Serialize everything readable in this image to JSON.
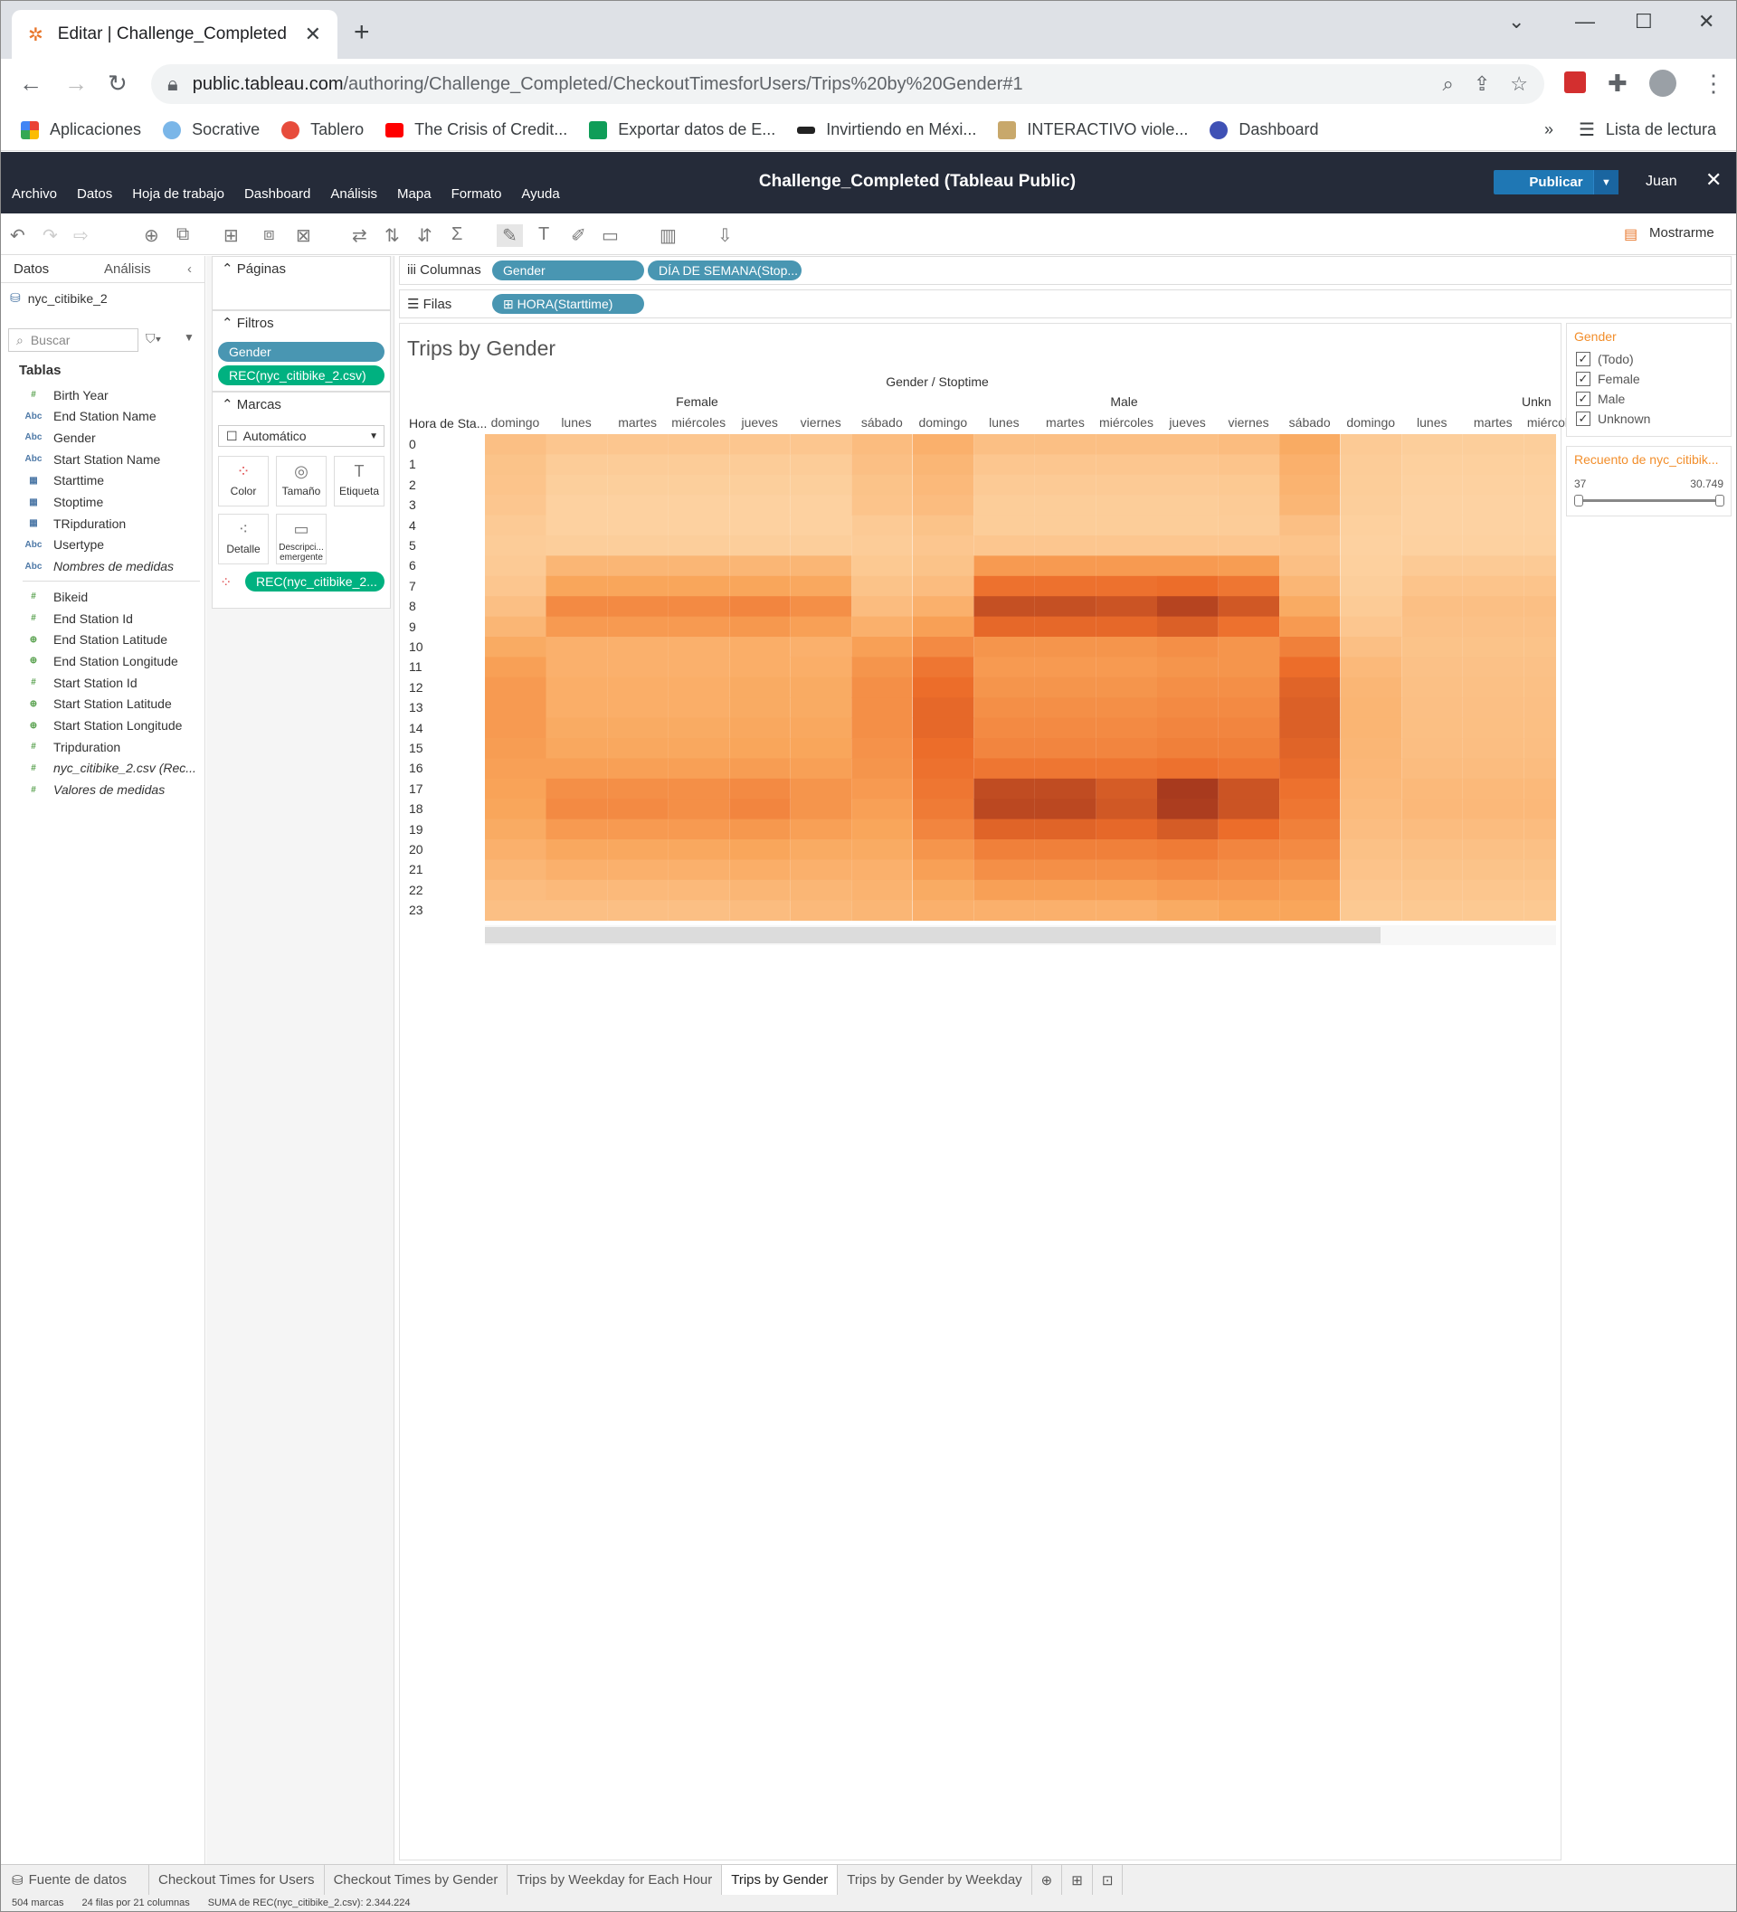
{
  "browser": {
    "tab_title": "Editar | Challenge_Completed",
    "url_host": "public.tableau.com",
    "url_path": "/authoring/Challenge_Completed/CheckoutTimesforUsers/Trips%20by%20Gender#1",
    "bookmarks": [
      "Aplicaciones",
      "Socrative",
      "Tablero",
      "The Crisis of Credit...",
      "Exportar datos de E...",
      "Invirtiendo en Méxi...",
      "INTERACTIVO viole...",
      "Dashboard"
    ],
    "bookmark_more": "»",
    "reading_list": "Lista de lectura"
  },
  "app": {
    "menu": [
      "Archivo",
      "Datos",
      "Hoja de trabajo",
      "Dashboard",
      "Análisis",
      "Mapa",
      "Formato",
      "Ayuda"
    ],
    "title": "Challenge_Completed (Tableau Public)",
    "publish": "Publicar",
    "user": "Juan",
    "showme": "Mostrarme"
  },
  "datapane": {
    "tab_data": "Datos",
    "tab_analysis": "Análisis",
    "datasource": "nyc_citibike_2",
    "search_placeholder": "Buscar",
    "tables_label": "Tablas",
    "fields": [
      {
        "icon": "#",
        "name": "Birth Year",
        "type": "m"
      },
      {
        "icon": "Abc",
        "name": "End Station Name",
        "type": "d"
      },
      {
        "icon": "Abc",
        "name": "Gender",
        "type": "d"
      },
      {
        "icon": "Abc",
        "name": "Start Station Name",
        "type": "d"
      },
      {
        "icon": "cal",
        "name": "Starttime",
        "type": "d"
      },
      {
        "icon": "cal",
        "name": "Stoptime",
        "type": "d"
      },
      {
        "icon": "cal",
        "name": "TRipduration",
        "type": "d"
      },
      {
        "icon": "Abc",
        "name": "Usertype",
        "type": "d"
      },
      {
        "icon": "Abc",
        "name": "Nombres de medidas",
        "type": "d"
      },
      {
        "icon": "#",
        "name": "Bikeid",
        "type": "m"
      },
      {
        "icon": "#",
        "name": "End Station Id",
        "type": "m"
      },
      {
        "icon": "geo",
        "name": "End Station Latitude",
        "type": "m"
      },
      {
        "icon": "geo",
        "name": "End Station Longitude",
        "type": "m"
      },
      {
        "icon": "#",
        "name": "Start Station Id",
        "type": "m"
      },
      {
        "icon": "geo",
        "name": "Start Station Latitude",
        "type": "m"
      },
      {
        "icon": "geo",
        "name": "Start Station Longitude",
        "type": "m"
      },
      {
        "icon": "#",
        "name": "Tripduration",
        "type": "m"
      },
      {
        "icon": "#",
        "name": "nyc_citibike_2.csv (Rec...",
        "type": "m"
      },
      {
        "icon": "#",
        "name": "Valores de medidas",
        "type": "m"
      }
    ]
  },
  "cards": {
    "pages": "Páginas",
    "filters": "Filtros",
    "filter_pills": [
      "Gender",
      "REC(nyc_citibike_2.csv)"
    ],
    "marks": "Marcas",
    "mark_type": "Automático",
    "mark_buttons": [
      "Color",
      "Tamaño",
      "Etiqueta",
      "Detalle",
      "Descripci... emergente"
    ],
    "color_pill": "REC(nyc_citibike_2..."
  },
  "shelves": {
    "columns_label": "Columnas",
    "columns_pills": [
      "Gender",
      "DÍA DE SEMANA(Stop..."
    ],
    "rows_label": "Filas",
    "rows_pills": [
      "⊞ HORA(Starttime)"
    ]
  },
  "viz": {
    "title": "Trips by Gender",
    "top_header": "Gender / Stoptime",
    "row_header_title": "Hora de Sta...",
    "genders": [
      "Female",
      "Male",
      "Unkn"
    ],
    "days": [
      "domingo",
      "lunes",
      "martes",
      "miércoles",
      "jueves",
      "viernes",
      "sábado"
    ],
    "hours": [
      "0",
      "1",
      "2",
      "3",
      "4",
      "5",
      "6",
      "7",
      "8",
      "9",
      "10",
      "11",
      "12",
      "13",
      "14",
      "15",
      "16",
      "17",
      "18",
      "19",
      "20",
      "21",
      "22",
      "23"
    ]
  },
  "legend_gender": {
    "title": "Gender",
    "items": [
      "(Todo)",
      "Female",
      "Male",
      "Unknown"
    ]
  },
  "legend_count": {
    "title": "Recuento de nyc_citibik...",
    "min": "37",
    "max": "30.749"
  },
  "sheets": {
    "datasource_tab": "Fuente de datos",
    "tabs": [
      "Checkout Times for Users",
      "Checkout Times by Gender",
      "Trips by Weekday for Each Hour",
      "Trips by Gender",
      "Trips by Gender by Weekday"
    ],
    "active": "Trips by Gender"
  },
  "status": [
    "504 marcas",
    "24 filas por 21 columnas",
    "SUMA de REC(nyc_citibike_2.csv): 2.344.224"
  ],
  "chart_data": {
    "type": "heatmap",
    "title": "Trips by Gender",
    "columns_header": "Gender / Stoptime",
    "rows_header": "Hora de Sta...",
    "color_range": [
      37,
      30749
    ],
    "color_scale": [
      "#fdd5a6",
      "#f9a55a",
      "#ec6d2a",
      "#a83a1e"
    ],
    "rows": [
      "0",
      "1",
      "2",
      "3",
      "4",
      "5",
      "6",
      "7",
      "8",
      "9",
      "10",
      "11",
      "12",
      "13",
      "14",
      "15",
      "16",
      "17",
      "18",
      "19",
      "20",
      "21",
      "22",
      "23"
    ],
    "series": [
      {
        "name": "Female",
        "days": [
          "domingo",
          "lunes",
          "martes",
          "miércoles",
          "jueves",
          "viernes",
          "sábado"
        ],
        "values": [
          [
            2500,
            1500,
            1500,
            1500,
            1500,
            1500,
            3000
          ],
          [
            2000,
            800,
            800,
            800,
            800,
            800,
            2500
          ],
          [
            1800,
            500,
            500,
            500,
            500,
            500,
            2000
          ],
          [
            1500,
            300,
            300,
            300,
            300,
            300,
            1800
          ],
          [
            1000,
            300,
            300,
            300,
            300,
            300,
            1000
          ],
          [
            800,
            600,
            600,
            600,
            600,
            600,
            800
          ],
          [
            1000,
            4000,
            4000,
            4000,
            4000,
            4000,
            1200
          ],
          [
            1500,
            7000,
            7000,
            7000,
            7000,
            6500,
            2000
          ],
          [
            2500,
            12000,
            12000,
            12000,
            13000,
            11000,
            3000
          ],
          [
            4000,
            9000,
            9000,
            9000,
            9500,
            8000,
            5000
          ],
          [
            6000,
            5000,
            5000,
            5000,
            5500,
            5000,
            8000
          ],
          [
            8000,
            5000,
            5000,
            5000,
            5500,
            5500,
            10000
          ],
          [
            9000,
            5500,
            5500,
            5500,
            6000,
            6000,
            11000
          ],
          [
            9000,
            5500,
            5500,
            5500,
            6000,
            6000,
            11000
          ],
          [
            9000,
            6000,
            6000,
            6000,
            6500,
            6500,
            11000
          ],
          [
            8500,
            6500,
            6500,
            6500,
            7000,
            7000,
            10500
          ],
          [
            8000,
            8000,
            8000,
            8000,
            8500,
            8000,
            10000
          ],
          [
            7500,
            11000,
            11000,
            11000,
            12000,
            10000,
            9000
          ],
          [
            7000,
            12000,
            12000,
            11000,
            13000,
            10000,
            8000
          ],
          [
            6000,
            9000,
            9000,
            9000,
            9500,
            8000,
            7000
          ],
          [
            5000,
            6500,
            6500,
            6500,
            7000,
            6000,
            6000
          ],
          [
            4000,
            5000,
            5000,
            5000,
            5500,
            5000,
            5000
          ],
          [
            3000,
            3500,
            3500,
            3500,
            4000,
            4000,
            4500
          ],
          [
            2500,
            2500,
            2500,
            2500,
            3000,
            3500,
            4000
          ]
        ]
      },
      {
        "name": "Male",
        "days": [
          "domingo",
          "lunes",
          "martes",
          "miércoles",
          "jueves",
          "viernes",
          "sábado"
        ],
        "values": [
          [
            5000,
            2500,
            2500,
            2500,
            2500,
            3000,
            6000
          ],
          [
            4000,
            1500,
            1500,
            1500,
            1500,
            1800,
            5000
          ],
          [
            3500,
            1000,
            1000,
            1000,
            1000,
            1200,
            4500
          ],
          [
            3000,
            700,
            700,
            700,
            700,
            900,
            4000
          ],
          [
            2000,
            700,
            700,
            700,
            700,
            800,
            2500
          ],
          [
            1500,
            1500,
            1500,
            1500,
            1500,
            1500,
            1800
          ],
          [
            2000,
            9000,
            9000,
            9000,
            9000,
            8500,
            2500
          ],
          [
            3000,
            17000,
            17000,
            17000,
            18000,
            16000,
            4000
          ],
          [
            5000,
            25000,
            25000,
            24000,
            28000,
            23000,
            6000
          ],
          [
            8000,
            19000,
            19000,
            19000,
            21000,
            17000,
            9000
          ],
          [
            12000,
            10000,
            10000,
            10000,
            11000,
            10000,
            14000
          ],
          [
            16000,
            9000,
            9000,
            9000,
            10000,
            10000,
            18000
          ],
          [
            18000,
            10000,
            10000,
            10000,
            11000,
            11000,
            20000
          ],
          [
            19000,
            11000,
            11000,
            11000,
            12000,
            12000,
            21000
          ],
          [
            19000,
            12000,
            12000,
            12000,
            13000,
            13000,
            21000
          ],
          [
            18000,
            13000,
            13000,
            13000,
            14000,
            14000,
            20000
          ],
          [
            17000,
            16000,
            16000,
            16000,
            17000,
            16000,
            19000
          ],
          [
            16000,
            26000,
            26000,
            22000,
            30749,
            24000,
            17000
          ],
          [
            15000,
            27000,
            27000,
            23000,
            30000,
            24000,
            16000
          ],
          [
            13000,
            20000,
            20000,
            19000,
            22000,
            18000,
            14000
          ],
          [
            10000,
            14000,
            14000,
            14000,
            15000,
            13000,
            12000
          ],
          [
            8000,
            11000,
            11000,
            11000,
            12000,
            11000,
            10000
          ],
          [
            6000,
            8000,
            8000,
            8000,
            9000,
            9000,
            8000
          ],
          [
            5000,
            5000,
            5000,
            5000,
            6000,
            7000,
            7000
          ]
        ]
      },
      {
        "name": "Unknown",
        "days": [
          "domingo",
          "lunes",
          "martes",
          "miércoles"
        ],
        "values": [
          [
            1000,
            600,
            600,
            600
          ],
          [
            800,
            400,
            400,
            400
          ],
          [
            700,
            300,
            300,
            300
          ],
          [
            600,
            200,
            200,
            200
          ],
          [
            400,
            200,
            200,
            200
          ],
          [
            300,
            300,
            300,
            300
          ],
          [
            400,
            1000,
            1000,
            1000
          ],
          [
            600,
            1800,
            1800,
            1800
          ],
          [
            900,
            2500,
            2500,
            2500
          ],
          [
            1500,
            2200,
            2200,
            2200
          ],
          [
            2500,
            2000,
            2000,
            2000
          ],
          [
            3500,
            2200,
            2200,
            2200
          ],
          [
            4000,
            2400,
            2400,
            2400
          ],
          [
            4200,
            2500,
            2500,
            2500
          ],
          [
            4200,
            2600,
            2600,
            2600
          ],
          [
            4000,
            2700,
            2700,
            2700
          ],
          [
            3800,
            3000,
            3000,
            3000
          ],
          [
            3500,
            3500,
            3500,
            3500
          ],
          [
            3200,
            3600,
            3600,
            3600
          ],
          [
            2800,
            3000,
            3000,
            3000
          ],
          [
            2300,
            2400,
            2400,
            2400
          ],
          [
            1900,
            2000,
            2000,
            2000
          ],
          [
            1500,
            1600,
            1600,
            1600
          ],
          [
            1200,
            1200,
            1200,
            1200
          ]
        ]
      }
    ]
  }
}
